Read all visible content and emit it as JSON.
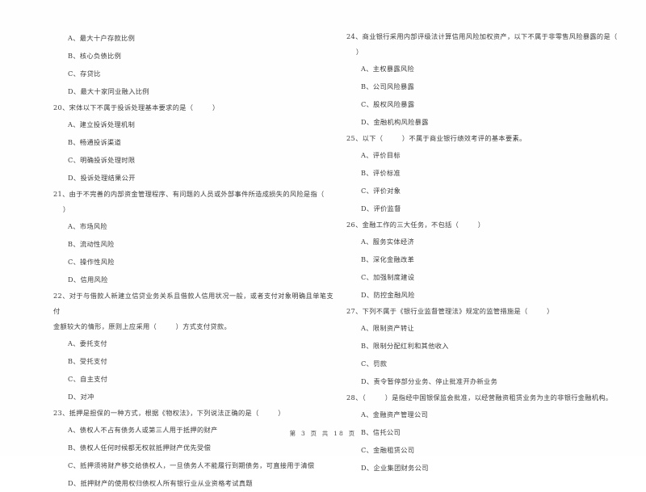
{
  "document": {
    "footer": "第 3 页 共 18 页",
    "page_number": "3",
    "total_pages": "18"
  },
  "columns": {
    "left": {
      "items": [
        {
          "kind": "option",
          "text": "A、最大十户存款比例"
        },
        {
          "kind": "option",
          "text": "B、核心负债比例"
        },
        {
          "kind": "option",
          "text": "C、存贷比"
        },
        {
          "kind": "option",
          "text": "D、最大十家同业融入比例"
        },
        {
          "kind": "stem",
          "text": "20、宋体以下不属于投诉处理基本要求的是（        ）"
        },
        {
          "kind": "option",
          "text": "A、建立投诉处理机制"
        },
        {
          "kind": "option",
          "text": "B、畅通投诉渠道"
        },
        {
          "kind": "option",
          "text": "C、明确投诉处理时限"
        },
        {
          "kind": "option",
          "text": "D、投诉处理结果公开"
        },
        {
          "kind": "stem",
          "text": "21、由于不完善的内部资金管理程序、有问题的人员或外部事件所造成损失的风险是指（\n    ）"
        },
        {
          "kind": "option",
          "text": "A、市场风险"
        },
        {
          "kind": "option",
          "text": "B、流动性风险"
        },
        {
          "kind": "option",
          "text": "C、操作性风险"
        },
        {
          "kind": "option",
          "text": "D、信用风险"
        },
        {
          "kind": "stem",
          "text": "22、对于与借款人新建立信贷业务关系且借款人信用状况一般，或者支付对象明确且单笔支付\n金额较大的情形，原则上应采用（        ）方式支付贷款。"
        },
        {
          "kind": "option",
          "text": "A、委托支付"
        },
        {
          "kind": "option",
          "text": "B、受托支付"
        },
        {
          "kind": "option",
          "text": "C、自主支付"
        },
        {
          "kind": "option",
          "text": "D、对冲"
        },
        {
          "kind": "stem",
          "text": "23、抵押是担保的一种方式，根据《物权法》，下列说法正确的是（        ）"
        },
        {
          "kind": "option",
          "text": "A、债权人不占有债务人或第三人用于抵押的财产"
        },
        {
          "kind": "option",
          "text": "B、债权人任何时候都无权就抵押财产优先受偿"
        },
        {
          "kind": "option",
          "text": "C、抵押须将财产移交给债权人，一旦债务人不能履行到期债务，可直接用于清偿"
        },
        {
          "kind": "option",
          "text": "D、抵押财产的使用权归债权人所有银行业从业资格考试真题"
        }
      ]
    },
    "right": {
      "items": [
        {
          "kind": "stem",
          "text": "24、商业银行采用内部评级法计算信用风险加权资产，以下不属于非零售风险暴露的是（\n    ）"
        },
        {
          "kind": "option",
          "text": "A、主权暴露风险"
        },
        {
          "kind": "option",
          "text": "B、公司风险暴露"
        },
        {
          "kind": "option",
          "text": "C、股权风险暴露"
        },
        {
          "kind": "option",
          "text": "D、金融机构风险暴露"
        },
        {
          "kind": "stem",
          "text": "25、以下（        ）不属于商业银行绩效考评的基本要素。"
        },
        {
          "kind": "option",
          "text": "A、评价目标"
        },
        {
          "kind": "option",
          "text": "B、评价标准"
        },
        {
          "kind": "option",
          "text": "C、评价对象"
        },
        {
          "kind": "option",
          "text": "D、评价监督"
        },
        {
          "kind": "stem",
          "text": "26、金融工作的三大任务，不包括（        ）"
        },
        {
          "kind": "option",
          "text": "A、服务实体经济"
        },
        {
          "kind": "option",
          "text": "B、深化金融改革"
        },
        {
          "kind": "option",
          "text": "C、加强制度建设"
        },
        {
          "kind": "option",
          "text": "D、防控金融风险"
        },
        {
          "kind": "stem",
          "text": "27、下列不属于《银行业监督管理法》规定的监管措施是（        ）"
        },
        {
          "kind": "option",
          "text": "A、限制资产转让"
        },
        {
          "kind": "option",
          "text": "B、限制分配红利和其他收入"
        },
        {
          "kind": "option",
          "text": "C、罚款"
        },
        {
          "kind": "option",
          "text": "D、责令暂停部分业务、停止批准开办新业务"
        },
        {
          "kind": "stem",
          "text": "28、（        ）是指经中国银保监会批准，以经营融资租赁业务为主的非银行金融机构。"
        },
        {
          "kind": "option",
          "text": "A、金融资产管理公司"
        },
        {
          "kind": "option",
          "text": "B、信托公司"
        },
        {
          "kind": "option",
          "text": "C、金融租赁公司"
        },
        {
          "kind": "option",
          "text": "D、企业集团财务公司"
        }
      ]
    }
  }
}
